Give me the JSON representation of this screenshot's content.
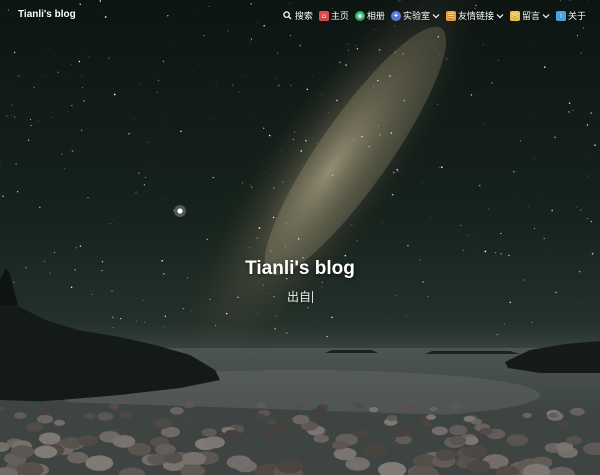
{
  "site": {
    "brand": "Tianli's blog"
  },
  "nav": {
    "items": [
      {
        "label": "搜索",
        "icon": "search-icon",
        "color": "#ffffff"
      },
      {
        "label": "主页",
        "icon": "home-icon",
        "color": "#e34b4b"
      },
      {
        "label": "相册",
        "icon": "album-icon",
        "color": "#2bb673"
      },
      {
        "label": "实验室",
        "icon": "lab-icon",
        "color": "#5b7be8",
        "dropdown": true
      },
      {
        "label": "友情链接",
        "icon": "links-icon",
        "color": "#f2a33a",
        "dropdown": true
      },
      {
        "label": "留言",
        "icon": "message-icon",
        "color": "#f5c542",
        "dropdown": true
      },
      {
        "label": "关于",
        "icon": "about-icon",
        "color": "#4aa3e8"
      }
    ]
  },
  "hero": {
    "title": "Tianli's blog",
    "subtitle": "出自"
  }
}
